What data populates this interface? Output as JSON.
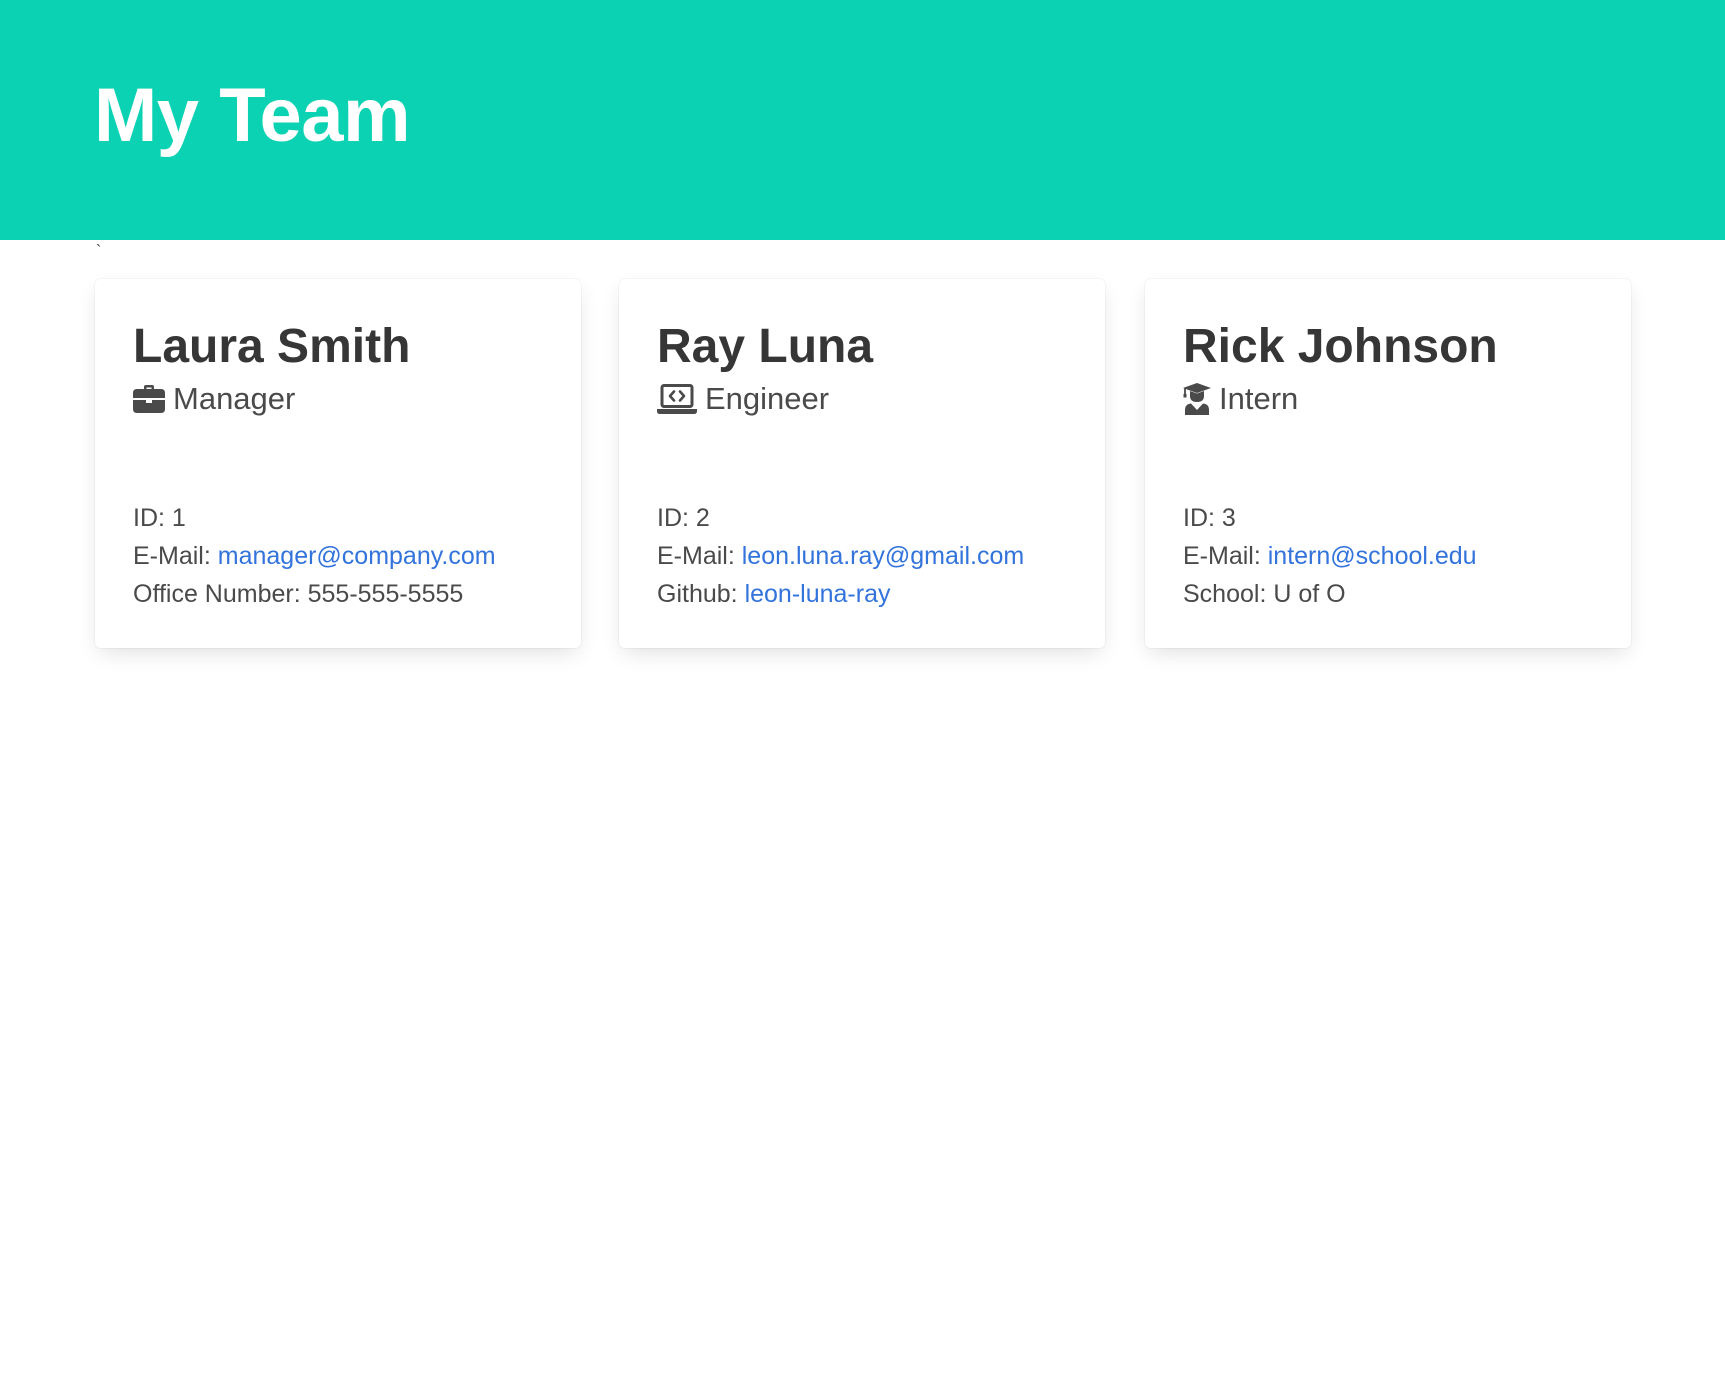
{
  "header": {
    "title": "My Team",
    "stray_char": "`",
    "background_color": "#0bd2b2"
  },
  "colors": {
    "link": "#3273dc",
    "text": "#363636"
  },
  "cards": [
    {
      "name": "Laura Smith",
      "role": "Manager",
      "role_icon": "briefcase-icon",
      "id_label": "ID:",
      "id_value": "1",
      "email_label": "E-Mail:",
      "email": "manager@company.com",
      "extra_label": "Office Number:",
      "extra_value": "555-555-5555"
    },
    {
      "name": "Ray Luna",
      "role": "Engineer",
      "role_icon": "laptop-code-icon",
      "id_label": "ID:",
      "id_value": "2",
      "email_label": "E-Mail:",
      "email": "leon.luna.ray@gmail.com",
      "extra_label": "Github:",
      "extra_value": "leon-luna-ray"
    },
    {
      "name": "Rick Johnson",
      "role": "Intern",
      "role_icon": "graduate-icon",
      "id_label": "ID:",
      "id_value": "3",
      "email_label": "E-Mail:",
      "email": "intern@school.edu",
      "extra_label": "School:",
      "extra_value": "U of O"
    }
  ]
}
